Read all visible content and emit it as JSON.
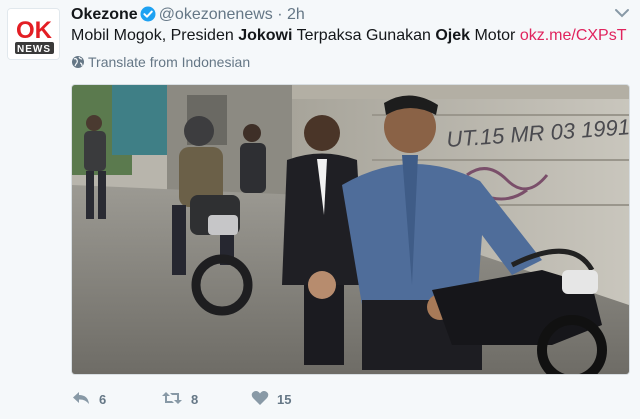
{
  "tweet": {
    "author": {
      "name": "Okezone",
      "handle": "@okezonenews",
      "logo_text_top": "OK",
      "logo_text_bottom": "NEWS",
      "verified": true
    },
    "separator": "·",
    "time": "2h",
    "text_parts": [
      "Mobil Mogok, Presiden ",
      "Jokowi",
      " Terpaksa Gunakan ",
      "Ojek",
      " Motor "
    ],
    "link": "okz.me/CXPsT",
    "translate_label": "Translate from Indonesian",
    "photo_graffiti": "UT.15 MR 03 1991",
    "actions": {
      "reply_count": "6",
      "retweet_count": "8",
      "like_count": "15"
    }
  },
  "icons": {
    "verified": "verified-badge-icon",
    "caret": "chevron-down-icon",
    "globe": "globe-icon",
    "reply": "reply-icon",
    "retweet": "retweet-icon",
    "like": "heart-icon"
  },
  "colors": {
    "link": "#e0245e",
    "secondary_text": "#657786",
    "verified": "#1da1f2",
    "logo_red": "#e31e24",
    "logo_dark": "#3a3a3a",
    "background": "#f5f8fa"
  }
}
